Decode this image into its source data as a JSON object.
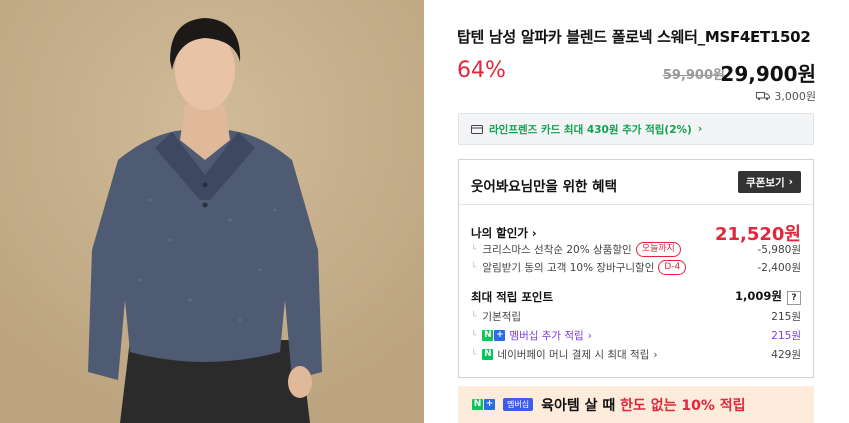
{
  "product": {
    "title": "탑텐 남성 알파카 블렌드 폴로넥 스웨터_MSF4ET1502",
    "discount_rate": "64%",
    "original_price": "59,900원",
    "price": "29,900원",
    "shipping": "3,000원"
  },
  "card_banner": "라인프렌즈 카드 최대 430원 추가 적립(2%)",
  "benefit": {
    "header": "웃어봐요님만을 위한 혜택",
    "coupon_button": "쿠폰보기",
    "my_price_label": "나의 할인가",
    "my_price": "21,520원",
    "discounts": [
      {
        "label": "크리스마스 선착순 20% 상품할인",
        "tag": "오늘까지",
        "amount": "-5,980원"
      },
      {
        "label": "알림받기 동의 고객 10% 장바구니할인",
        "tag": "D-4",
        "amount": "-2,400원"
      }
    ],
    "points_label": "최대 적립 포인트",
    "points_total": "1,009원",
    "points_help": "?",
    "points": [
      {
        "label": "기본적립",
        "amount": "215원"
      },
      {
        "label": "멤버십 추가 적립",
        "amount": "215원"
      },
      {
        "label": "네이버페이 머니 결제 시 최대 적립",
        "amount": "429원"
      }
    ]
  },
  "ad": {
    "badge": "멤버십",
    "text_pre": "육아템 살 때 ",
    "text_highlight": "한도 없는 10% 적립"
  },
  "colors": {
    "accent_red": "#e3263b",
    "naver_green": "#03c75a",
    "membership_purple": "#7a3de0"
  }
}
